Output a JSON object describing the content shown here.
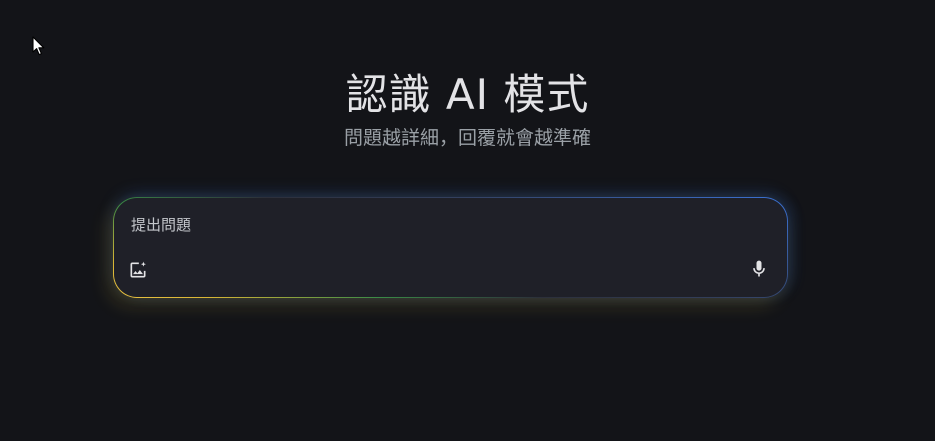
{
  "header": {
    "title": "認識 AI 模式",
    "subtitle": "問題越詳細，回覆就會越準確"
  },
  "search": {
    "placeholder": "提出問題",
    "value": ""
  },
  "icons": {
    "add_image": "add-image-icon",
    "microphone": "microphone-icon",
    "cursor": "mouse-cursor-icon"
  },
  "colors": {
    "background": "#131418",
    "box_background": "#1f2028",
    "glow_blue": "#4285f4",
    "glow_yellow": "#e8c243",
    "glow_green": "#3a8a46"
  }
}
